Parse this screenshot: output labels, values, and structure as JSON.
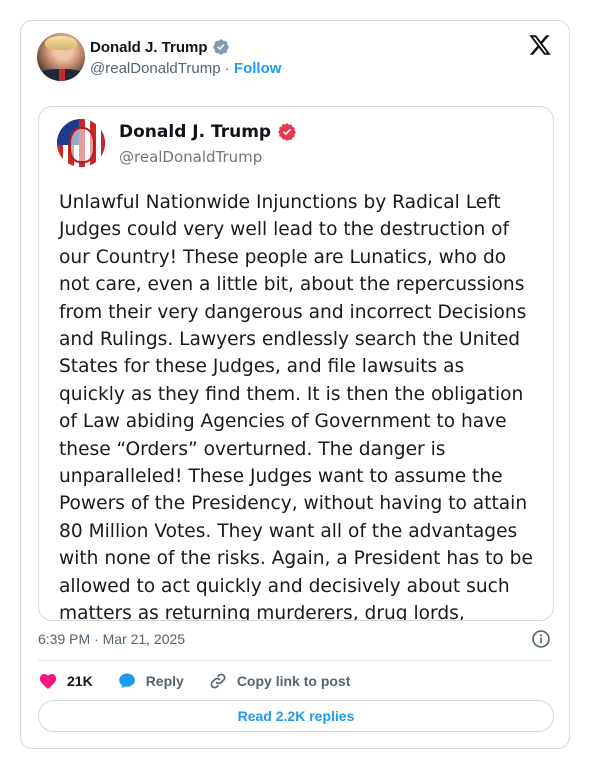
{
  "header": {
    "name": "Donald J. Trump",
    "handle": "@realDonaldTrump",
    "separator": "·",
    "follow_label": "Follow"
  },
  "embedded_post": {
    "name": "Donald J. Trump",
    "handle": "@realDonaldTrump",
    "text": "Unlawful Nationwide Injunctions by Radical Left\nJudges could very well lead to the destruction of\nour Country! These people are Lunatics, who do\nnot care, even a little bit, about the repercussions\nfrom their very dangerous and incorrect Decisions\nand Rulings. Lawyers endlessly search the United\nStates for these Judges, and file lawsuits as\nquickly as they find them. It is then the obligation\nof Law abiding Agencies of Government to have\nthese “Orders” overturned. The danger is\nunparalleled! These Judges want to assume the\nPowers of the Presidency, without having to attain\n80 Million Votes. They want all of the advantages\nwith none of the risks. Again, a President has to be\nallowed to act quickly and decisively about such\nmatters as returning murderers, drug lords,"
  },
  "meta": {
    "timestamp": "6:39 PM · Mar 21, 2025"
  },
  "actions": {
    "likes": "21K",
    "reply_label": "Reply",
    "copy_link_label": "Copy link to post"
  },
  "replies_button": "Read 2.2K replies",
  "colors": {
    "accent": "#1d9bf0",
    "heart": "#f91880",
    "muted": "#536471",
    "truth_badge": "#e53950"
  },
  "icons": {
    "x_logo": "x-logo-icon",
    "verified": "verified-badge-icon",
    "info": "info-icon",
    "heart": "heart-icon",
    "reply": "reply-bubble-icon",
    "link": "link-icon"
  }
}
